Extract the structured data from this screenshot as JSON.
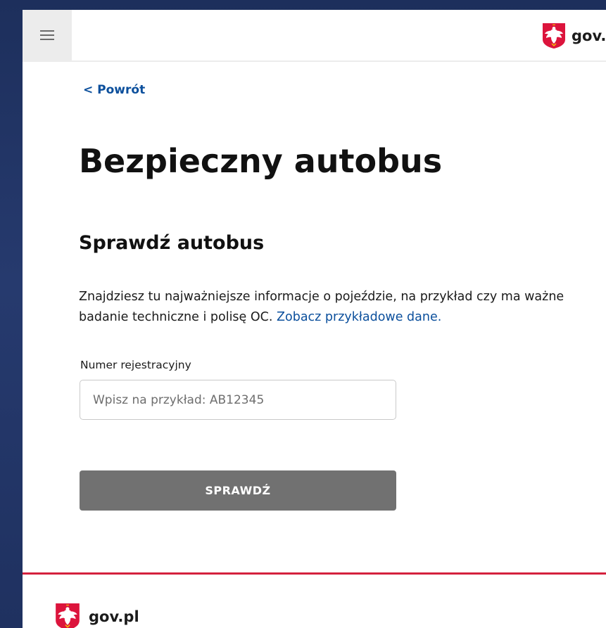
{
  "header": {
    "menu_icon": "hamburger-menu-icon",
    "logo_icon": "polish-eagle-emblem-icon",
    "logo_text": "gov.pl"
  },
  "main": {
    "back_link": "< Powrót",
    "page_title": "Bezpieczny autobus",
    "section_title": "Sprawdź autobus",
    "description": "Znajdziesz tu najważniejsze informacje o pojeździe, na przykład czy ma ważne badanie techniczne i polisę OC.",
    "example_link": "Zobacz przykładowe dane.",
    "registration_field": {
      "label": "Numer rejestracyjny",
      "placeholder": "Wpisz na przykład: AB12345",
      "value": ""
    },
    "submit_label": "SPRAWDŹ"
  },
  "footer": {
    "logo_icon": "polish-eagle-emblem-icon",
    "logo_text": "gov.pl"
  },
  "colors": {
    "background": "#1f3160",
    "link": "#0b4f9c",
    "button": "#717171",
    "footer_accent": "#d4213d",
    "emblem_red": "#dc143c"
  }
}
